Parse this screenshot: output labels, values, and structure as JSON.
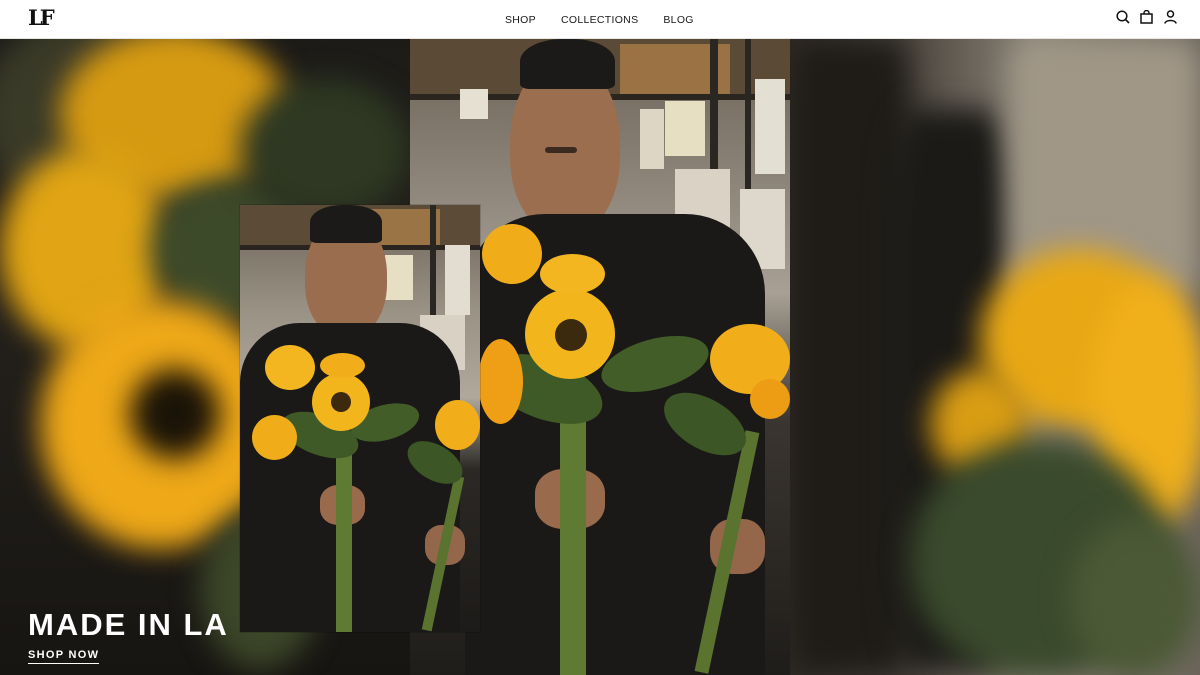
{
  "header": {
    "logo_text": "LF",
    "nav": [
      {
        "label": "SHOP"
      },
      {
        "label": "COLLECTIONS"
      },
      {
        "label": "BLOG"
      }
    ],
    "icons": [
      "search-icon",
      "shopping-bag-icon",
      "account-icon"
    ]
  },
  "hero": {
    "title": "MADE IN LA",
    "cta_label": "SHOP NOW"
  },
  "colors": {
    "header_bg": "#ffffff",
    "hero_text": "#ffffff",
    "sunflower": "#f2b51c"
  }
}
